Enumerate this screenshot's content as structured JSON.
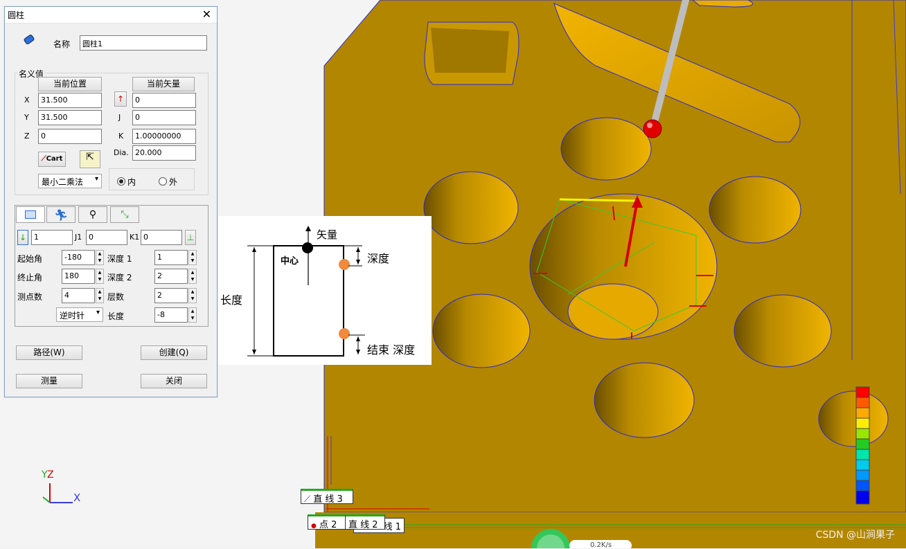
{
  "dialog": {
    "title": "圆柱",
    "name_label": "名称",
    "name_value": "圆柱1",
    "nominal_label": "名义值",
    "current_position_button": "当前位置",
    "current_vector_button": "当前矢量",
    "x_label": "X",
    "x_value": "31.500",
    "y_label": "Y",
    "y_value": "31.500",
    "z_label": "Z",
    "z_value": "0",
    "i_value": "0",
    "j_label": "J",
    "j_value": "0",
    "k_label": "K",
    "k_value": "1.00000000",
    "dia_label": "Dia.",
    "dia_value": "20.000",
    "cart_button": "Cart",
    "fit_method": "最小二乘法",
    "inner_label": "内",
    "outer_label": "外",
    "inner_selected": true,
    "i1_value": "1",
    "j1_label": "J1",
    "j1_value": "0",
    "k1_label": "K1",
    "k1_value": "0",
    "start_angle_label": "起始角",
    "start_angle_value": "-180",
    "end_angle_label": "终止角",
    "end_angle_value": "180",
    "points_label": "测点数",
    "points_value": "4",
    "depth1_label": "深度 1",
    "depth1_value": "1",
    "depth2_label": "深度 2",
    "depth2_value": "2",
    "layers_label": "层数",
    "layers_value": "2",
    "direction_value": "逆时针",
    "length_label": "长度",
    "length_value": "-8",
    "path_button": "路径(W)",
    "create_button": "创建(Q)",
    "measure_button": "测量",
    "close_button": "关闭"
  },
  "diagram": {
    "vector_label": "矢量",
    "center_label": "中心",
    "depth_label": "深度",
    "length_label": "长度",
    "end_depth_label": "结束 深度"
  },
  "scene": {
    "tags": {
      "line3": "直 线 3",
      "point2": "点 2",
      "line2": "直 线 2",
      "line1": "线 1"
    },
    "axis_y": "Y",
    "axis_z": "Z",
    "axis_x": "X",
    "hud_text": "0.2K/s"
  },
  "watermark": "CSDN @山涧果子",
  "colors": {
    "part": "#b38800",
    "hole_light": "#e0a800",
    "accent_red": "#d40000"
  }
}
